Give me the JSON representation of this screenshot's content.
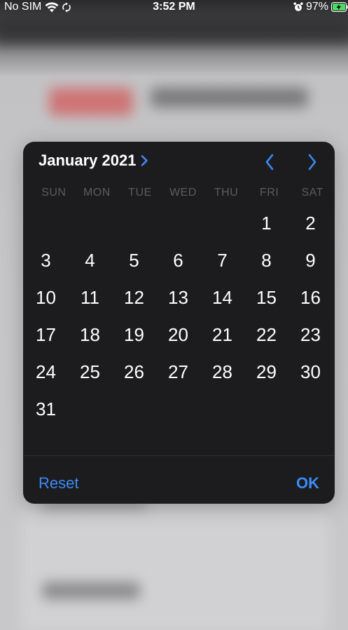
{
  "status_bar": {
    "carrier": "No SIM",
    "time": "3:52 PM",
    "battery_percent": "97%",
    "icons": [
      "wifi-icon",
      "sync-icon",
      "alarm-icon",
      "battery-charging-icon"
    ]
  },
  "picker": {
    "month_year": "January 2021",
    "weekdays": [
      "SUN",
      "MON",
      "TUE",
      "WED",
      "THU",
      "FRI",
      "SAT"
    ],
    "leading_blank_days": 5,
    "days": [
      "1",
      "2",
      "3",
      "4",
      "5",
      "6",
      "7",
      "8",
      "9",
      "10",
      "11",
      "12",
      "13",
      "14",
      "15",
      "16",
      "17",
      "18",
      "19",
      "20",
      "21",
      "22",
      "23",
      "24",
      "25",
      "26",
      "27",
      "28",
      "29",
      "30",
      "31"
    ],
    "reset_label": "Reset",
    "ok_label": "OK"
  },
  "colors": {
    "accent": "#3b8cf5",
    "picker_bg": "#1c1c1e",
    "weekday_text": "#5c5c60",
    "battery_fill": "#4cd964"
  }
}
